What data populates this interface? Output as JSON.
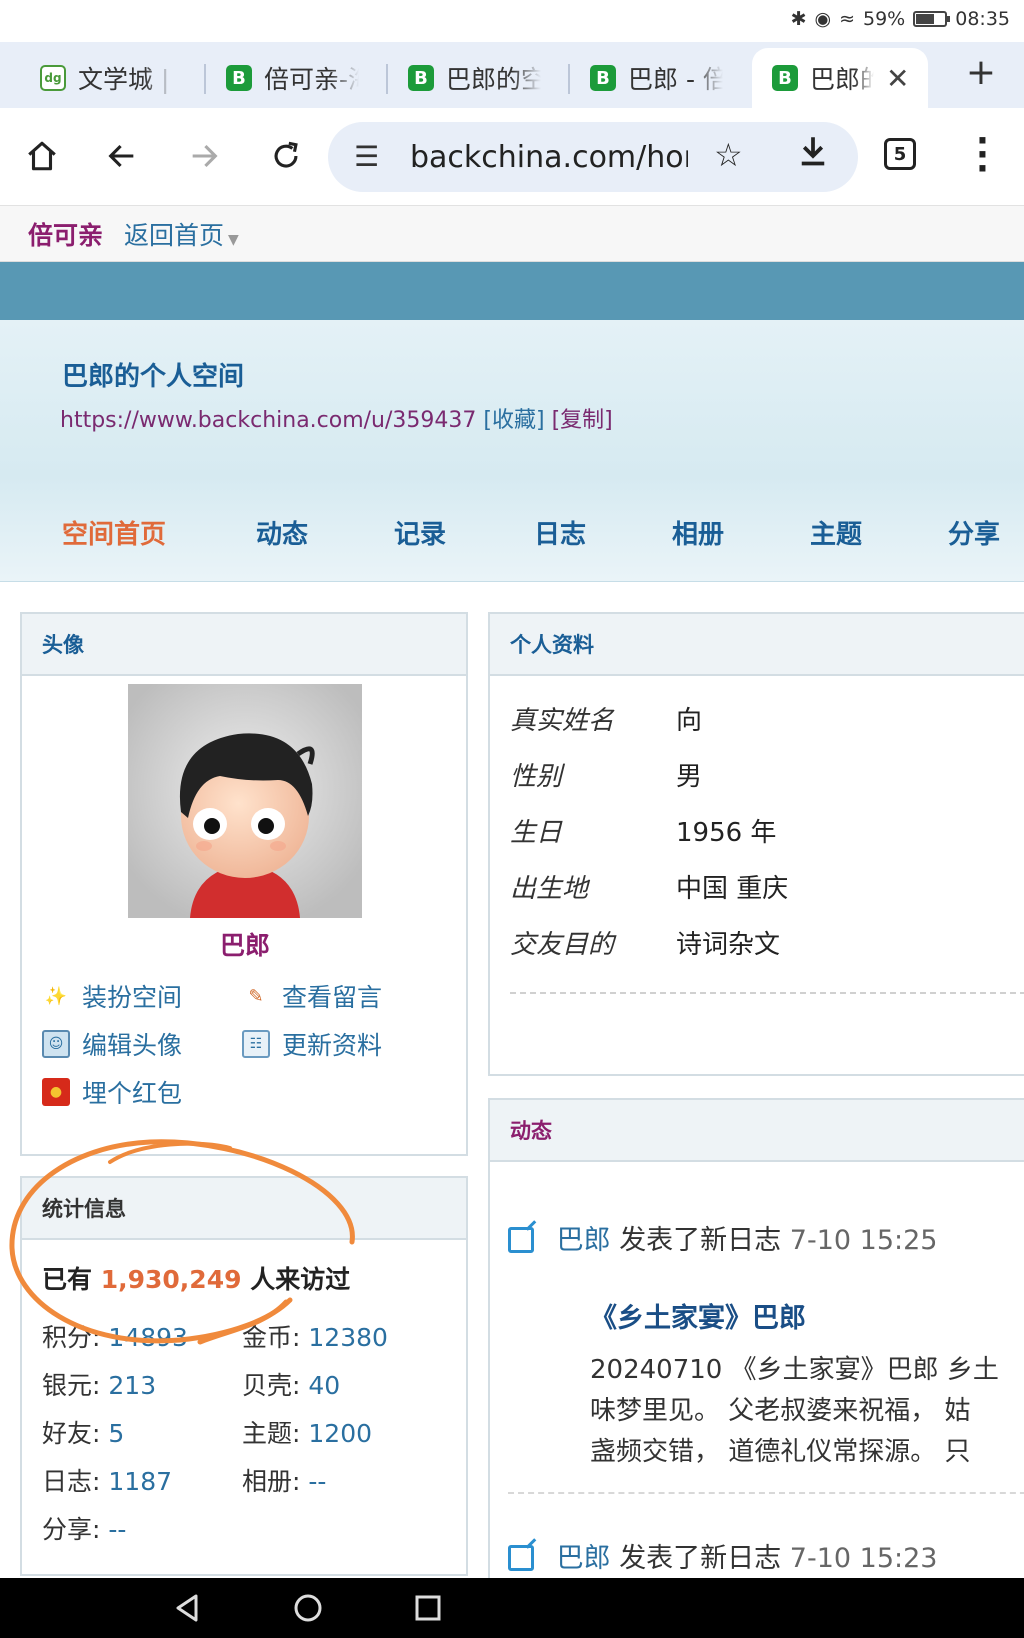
{
  "status_bar": {
    "battery": "59%",
    "battery_level": 0.59,
    "time": "08:35"
  },
  "tabs": [
    {
      "favicon": "wxc",
      "title": "文学城 |"
    },
    {
      "favicon": "B",
      "title": "倍可亲-海"
    },
    {
      "favicon": "B",
      "title": "巴郎的空"
    },
    {
      "favicon": "B",
      "title": "巴郎 - 倍"
    },
    {
      "favicon": "B",
      "title": "巴郎的",
      "active": true
    }
  ],
  "toolbar": {
    "url": "backchina.com/hon",
    "tab_count": "5"
  },
  "site": {
    "logo": "倍可亲",
    "home_link": "返回首页"
  },
  "space": {
    "title": "巴郎的个人空间",
    "url": "https://www.backchina.com/u/359437",
    "bookmark": "[收藏]",
    "copy": "[复制]",
    "nav": [
      "空间首页",
      "动态",
      "记录",
      "日志",
      "相册",
      "主题",
      "分享"
    ]
  },
  "avatar_panel": {
    "heading": "头像",
    "username": "巴郎",
    "actions": [
      "装扮空间",
      "查看留言",
      "编辑头像",
      "更新资料",
      "埋个红包"
    ]
  },
  "stats_panel": {
    "heading": "统计信息",
    "visitors_prefix": "已有",
    "visitors": "1,930,249",
    "visitors_suffix": "人来访过",
    "items": [
      {
        "label": "积分",
        "value": "14893"
      },
      {
        "label": "金币",
        "value": "12380"
      },
      {
        "label": "银元",
        "value": "213"
      },
      {
        "label": "贝壳",
        "value": "40"
      },
      {
        "label": "好友",
        "value": "5"
      },
      {
        "label": "主题",
        "value": "1200"
      },
      {
        "label": "日志",
        "value": "1187"
      },
      {
        "label": "相册",
        "value": "--"
      },
      {
        "label": "分享",
        "value": "--"
      }
    ]
  },
  "profile_panel": {
    "heading": "个人资料",
    "rows": [
      {
        "label": "真实姓名",
        "value": "向"
      },
      {
        "label": "性别",
        "value": "男"
      },
      {
        "label": "生日",
        "value": "1956 年"
      },
      {
        "label": "出生地",
        "value": "中国 重庆"
      },
      {
        "label": "交友目的",
        "value": "诗词杂文"
      }
    ]
  },
  "feed_panel": {
    "heading": "动态",
    "items": [
      {
        "who": "巴郎",
        "action": "发表了新日志",
        "time": "7-10 15:25",
        "title": "《乡土家宴》巴郎",
        "lines": [
          "20240710 《乡土家宴》巴郎 乡土",
          "味梦里见。 父老叔婆来祝福， 姑",
          "盏频交错， 道德礼仪常探源。 只"
        ]
      },
      {
        "who": "巴郎",
        "action": "发表了新日志",
        "time": "7-10 15:23"
      }
    ]
  },
  "colors": {
    "teal_band": "#5898b4",
    "link_blue": "#2a6fa0",
    "accent_orange": "#e06a3a",
    "brand_purple": "#8b1e6e",
    "annotation": "#f08a3c"
  }
}
